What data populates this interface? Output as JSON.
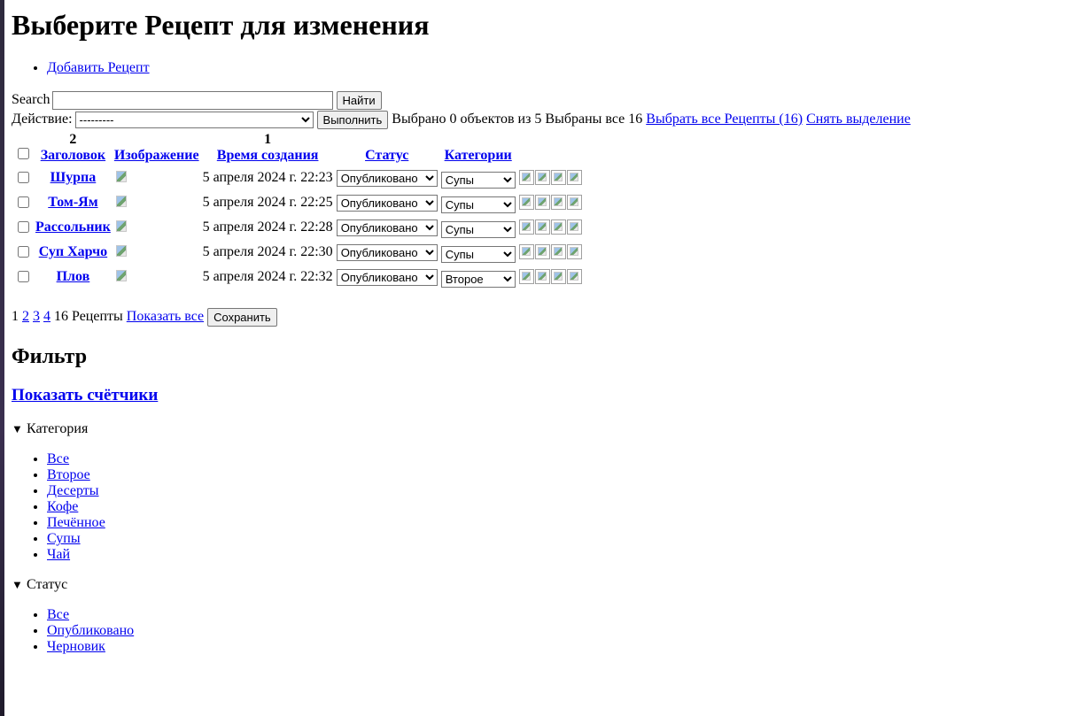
{
  "page": {
    "title": "Выберите Рецепт для изменения",
    "add_link": "Добавить Рецепт"
  },
  "search": {
    "image_alt": "Search",
    "value": "",
    "button": "Найти"
  },
  "actions": {
    "label": "Действие:",
    "selected": "---------",
    "run_button": "Выполнить",
    "selected_text": "Выбрано 0 объектов из 5",
    "selected_all_text": "Выбраны все 16",
    "select_all_link": "Выбрать все Рецепты (16)",
    "clear_link": "Снять выделение"
  },
  "table": {
    "headers": [
      {
        "rank": "2",
        "label": "Заголовок"
      },
      {
        "rank": "",
        "label": "Изображение"
      },
      {
        "rank": "1",
        "label": "Время создания"
      },
      {
        "rank": "",
        "label": "Статус"
      },
      {
        "rank": "",
        "label": "Категории"
      }
    ],
    "rows": [
      {
        "title": "Шурпа",
        "created": "5 апреля 2024 г. 22:23",
        "status": "Опубликовано",
        "category": "Супы"
      },
      {
        "title": "Том-Ям",
        "created": "5 апреля 2024 г. 22:25",
        "status": "Опубликовано",
        "category": "Супы"
      },
      {
        "title": "Рассольник",
        "created": "5 апреля 2024 г. 22:28",
        "status": "Опубликовано",
        "category": "Супы"
      },
      {
        "title": "Суп Харчо",
        "created": "5 апреля 2024 г. 22:30",
        "status": "Опубликовано",
        "category": "Супы"
      },
      {
        "title": "Плов",
        "created": "5 апреля 2024 г. 22:32",
        "status": "Опубликовано",
        "category": "Второе"
      }
    ]
  },
  "pagination": {
    "current": "1",
    "pages": [
      "2",
      "3",
      "4"
    ],
    "count_text": "16 Рецепты",
    "show_all": "Показать все",
    "save_button": "Сохранить"
  },
  "filter": {
    "title": "Фильтр",
    "show_counters": "Показать счётчики",
    "category": {
      "label": "Категория",
      "items": [
        "Все",
        "Второе",
        "Десерты",
        "Кофе",
        "Печённое",
        "Супы",
        "Чай"
      ]
    },
    "status": {
      "label": "Статус",
      "items": [
        "Все",
        "Опубликовано",
        "Черновик"
      ]
    }
  }
}
